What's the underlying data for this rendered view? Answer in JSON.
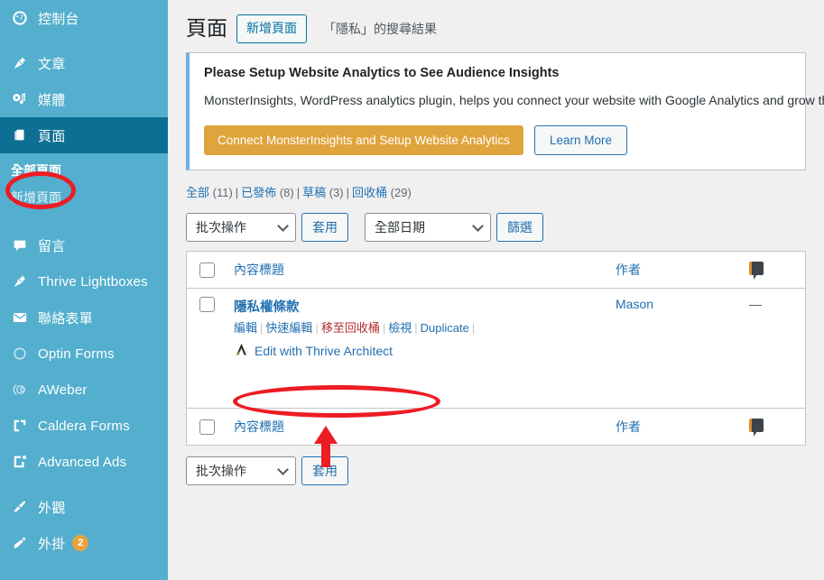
{
  "sidebar": {
    "items": [
      {
        "label": "控制台",
        "icon": "dashboard-icon",
        "current": false
      },
      {
        "label": "文章",
        "icon": "posts-pin-icon",
        "current": false
      },
      {
        "label": "媒體",
        "icon": "media-icon",
        "current": false
      },
      {
        "label": "頁面",
        "icon": "pages-icon",
        "current": true
      },
      {
        "label": "留言",
        "icon": "comments-icon",
        "current": false
      },
      {
        "label": "Thrive Lightboxes",
        "icon": "pin-icon",
        "current": false
      },
      {
        "label": "聯絡表單",
        "icon": "envelope-icon",
        "current": false
      },
      {
        "label": "Optin Forms",
        "icon": "circle-icon",
        "current": false
      },
      {
        "label": "AWeber",
        "icon": "aweber-icon",
        "current": false
      },
      {
        "label": "Caldera Forms",
        "icon": "caldera-icon",
        "current": false
      },
      {
        "label": "Advanced Ads",
        "icon": "advanced-ads-icon",
        "current": false
      },
      {
        "label": "外觀",
        "icon": "appearance-brush-icon",
        "current": false
      },
      {
        "label": "外掛",
        "icon": "plugins-icon",
        "current": false,
        "badge": "2"
      }
    ],
    "submenu": [
      {
        "label": "全部頁面",
        "current": true
      },
      {
        "label": "新增頁面",
        "current": false
      }
    ]
  },
  "header": {
    "title": "頁面",
    "add_new_label": "新增頁面",
    "search_subtitle": "「隱私」的搜尋結果"
  },
  "notice": {
    "heading": "Please Setup Website Analytics to See Audience Insights",
    "body": "MonsterInsights, WordPress analytics plugin, helps you connect your website with Google Analytics and grow their business.",
    "primary_button": "Connect MonsterInsights and Setup Website Analytics",
    "secondary_button": "Learn More",
    "accent_color": "#E0A43C",
    "border_color": "#72aee6"
  },
  "views": [
    {
      "label": "全部",
      "count": "(11)"
    },
    {
      "label": "已發佈",
      "count": "(8)"
    },
    {
      "label": "草稿",
      "count": "(3)"
    },
    {
      "label": "回收桶",
      "count": "(29)"
    }
  ],
  "tablenav_top": {
    "bulk_action_value": "批次操作",
    "apply_label": "套用",
    "date_filter_value": "全部日期",
    "filter_label": "篩選"
  },
  "tablenav_bottom": {
    "bulk_action_value": "批次操作",
    "apply_label": "套用"
  },
  "table": {
    "columns": {
      "title": "內容標題",
      "author": "作者",
      "comments": "comment-bubble-icon"
    },
    "rows": [
      {
        "title": "隱私權條款",
        "author": "Mason",
        "comments": "—",
        "actions": [
          {
            "label": "編輯",
            "type": "link"
          },
          {
            "label": "快速編輯",
            "type": "link"
          },
          {
            "label": "移至回收桶",
            "type": "trash"
          },
          {
            "label": "檢視",
            "type": "link"
          },
          {
            "label": "Duplicate",
            "type": "link"
          }
        ],
        "thrive_label": "Edit with Thrive Architect"
      }
    ]
  },
  "annotations": {
    "highlight_color": "#ED1C24",
    "ellipse_sidebar_target": "全部頁面",
    "ellipse_row_target": "Edit with Thrive Architect",
    "arrow_target": "Edit with Thrive Architect"
  }
}
